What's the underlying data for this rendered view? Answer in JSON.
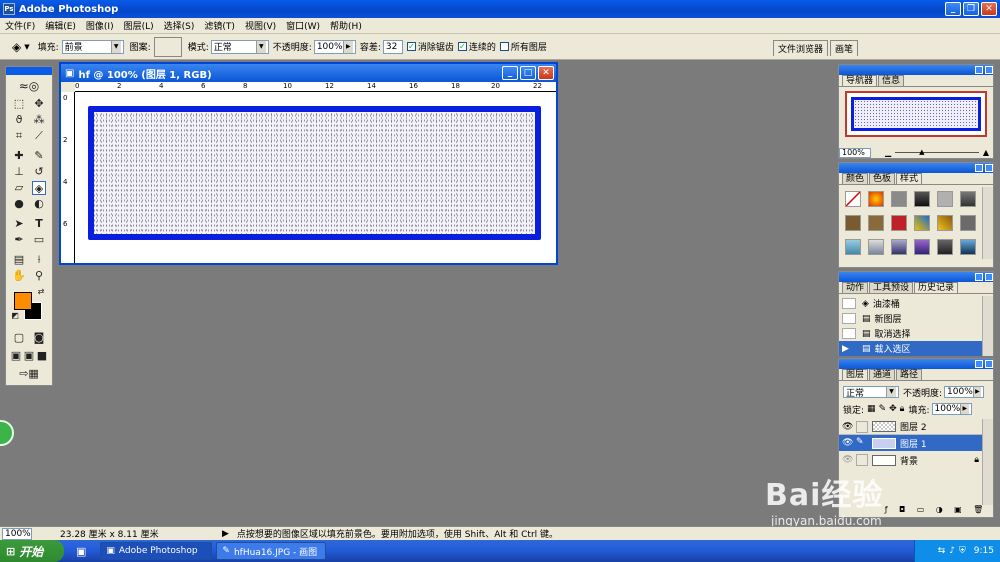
{
  "app": {
    "title": "Adobe Photoshop"
  },
  "menu": [
    "文件(F)",
    "编辑(E)",
    "图像(I)",
    "图层(L)",
    "选择(S)",
    "滤镜(T)",
    "视图(V)",
    "窗口(W)",
    "帮助(H)"
  ],
  "options": {
    "fill_label": "填充:",
    "fill_value": "前景",
    "pattern_label": "图案:",
    "mode_label": "模式:",
    "mode_value": "正常",
    "opacity_label": "不透明度:",
    "opacity_value": "100%",
    "tolerance_label": "容差:",
    "tolerance_value": "32",
    "antialias_label": "消除锯齿",
    "contiguous_label": "连续的",
    "alllayers_label": "所有图层",
    "well_tabs": [
      "文件浏览器",
      "画笔"
    ]
  },
  "document": {
    "title": "hf @ 100% (图层 1, RGB)",
    "ruler_h": [
      "0",
      "2",
      "4",
      "6",
      "8",
      "10",
      "12",
      "14",
      "16",
      "18",
      "20",
      "22"
    ],
    "ruler_v": [
      "0",
      "2",
      "4",
      "6"
    ]
  },
  "navigator": {
    "tabs": [
      "导航器",
      "信息"
    ],
    "zoom": "100%"
  },
  "styles": {
    "tabs": [
      "颜色",
      "色板",
      "样式"
    ]
  },
  "history": {
    "tabs": [
      "动作",
      "工具预设",
      "历史记录"
    ],
    "items": [
      "油漆桶",
      "新图层",
      "取消选择",
      "载入选区"
    ],
    "selected": 3
  },
  "layers": {
    "tabs": [
      "图层",
      "通道",
      "路径"
    ],
    "blend": "正常",
    "opacity_label": "不透明度:",
    "opacity": "100%",
    "lock_label": "锁定:",
    "fill_label": "填充:",
    "fill": "100%",
    "items": [
      "图层 2",
      "图层 1",
      "背景"
    ],
    "selected": 1
  },
  "status": {
    "zoom": "100%",
    "docsize": "23.28 厘米 x 8.11 厘米",
    "hint": "点按想要的图像区域以填充前景色。要用附加选项，使用 Shift、Alt 和 Ctrl 键。"
  },
  "taskbar": {
    "start": "开始",
    "tasks": [
      "Adobe Photoshop",
      "hfHua16.JPG - 画图"
    ],
    "clock": "9:15"
  },
  "watermark": {
    "brand": "Bai经验",
    "url": "jingyan.baidu.com"
  },
  "colors": {
    "foreground": "#ff8c00",
    "background": "#000000",
    "frame": "#0a1ee0"
  }
}
